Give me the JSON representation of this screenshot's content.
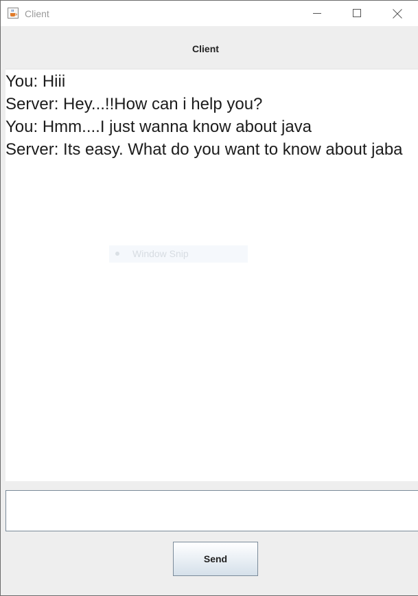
{
  "window": {
    "title": "Client",
    "icon": "java-cup-icon"
  },
  "titlebar_buttons": {
    "minimize": "minimize-icon",
    "maximize": "maximize-icon",
    "close": "close-icon"
  },
  "header": {
    "title": "Client"
  },
  "chat": {
    "messages": [
      "You: Hiii",
      "Server: Hey...!!How can i help you?",
      "You: Hmm....I just wanna know about java",
      "Server: Its easy. What do you want to know about jaba"
    ]
  },
  "overlay": {
    "label": "Window Snip"
  },
  "input": {
    "value": ""
  },
  "send": {
    "label": "Send"
  },
  "colors": {
    "window_bg": "#eeeeee",
    "titlebar_bg": "#ffffff",
    "chat_bg": "#ffffff",
    "button_border": "#7a8a99"
  }
}
